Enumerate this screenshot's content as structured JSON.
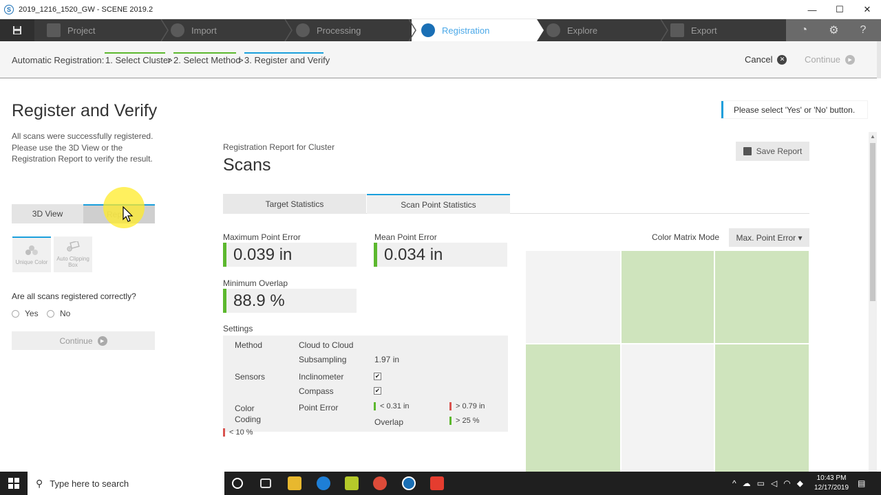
{
  "window": {
    "title": "2019_1216_1520_GW - SCENE 2019.2",
    "minimize": "—",
    "maximize": "☐",
    "close": "✕"
  },
  "nav": {
    "steps": [
      {
        "label": "Project",
        "icon": "project-icon"
      },
      {
        "label": "Import",
        "icon": "import-icon"
      },
      {
        "label": "Processing",
        "icon": "processing-icon"
      },
      {
        "label": "Registration",
        "icon": "registration-icon"
      },
      {
        "label": "Explore",
        "icon": "explore-icon"
      },
      {
        "label": "Export",
        "icon": "export-icon"
      }
    ],
    "active": "Registration"
  },
  "breadcrumb": {
    "label": "Automatic Registration:",
    "step1": "1. Select Cluster",
    "sep": ">",
    "step2": "2. Select Method",
    "step3": "3. Register and Verify",
    "cancel": "Cancel",
    "continue": "Continue",
    "colors": {
      "done": "#5cb82e",
      "current": "#1a9fdc"
    }
  },
  "left": {
    "title": "Register and Verify",
    "description": "All scans were successfully registered. Please use the 3D View or the Registration Report to verify the result.",
    "tab_3d": "3D View",
    "tab_report": "Report",
    "unique_color": "Unique Color",
    "auto_clipping": "Auto Clipping Box",
    "question": "Are all scans registered correctly?",
    "yes": "Yes",
    "no": "No",
    "continue": "Continue"
  },
  "notice": "Please select 'Yes' or 'No' button.",
  "report": {
    "subtitle": "Registration Report for Cluster",
    "title": "Scans",
    "save": "Save Report",
    "tab_target": "Target Statistics",
    "tab_scanpoint": "Scan Point Statistics",
    "max_error_label": "Maximum Point Error",
    "max_error": "0.039 in",
    "mean_error_label": "Mean Point Error",
    "mean_error": "0.034 in",
    "min_overlap_label": "Minimum Overlap",
    "min_overlap": "88.9 %",
    "settings_label": "Settings",
    "method_label": "Method",
    "method_value": "Cloud to Cloud",
    "subsampling_label": "Subsampling",
    "subsampling_value": "1.97 in",
    "sensors_label": "Sensors",
    "inclinometer": "Inclinometer",
    "compass": "Compass",
    "checkmark": "✔",
    "color_coding_label": "Color Coding",
    "point_error_label": "Point Error",
    "pe_good": "< 0.31 in",
    "pe_bad": "> 0.79 in",
    "overlap_label": "Overlap",
    "ov_good": "> 25 %",
    "ov_bad": "< 10 %",
    "color_matrix_label": "Color Matrix Mode",
    "color_matrix_value": "Max. Point Error ▾",
    "matrix_colors": {
      "green": "#cfe4bd",
      "gray": "#f3f3f3",
      "diag": "#f3f3f3"
    }
  },
  "taskbar": {
    "search": "Type here to search",
    "time": "10:43 PM",
    "date": "12/17/2019"
  }
}
